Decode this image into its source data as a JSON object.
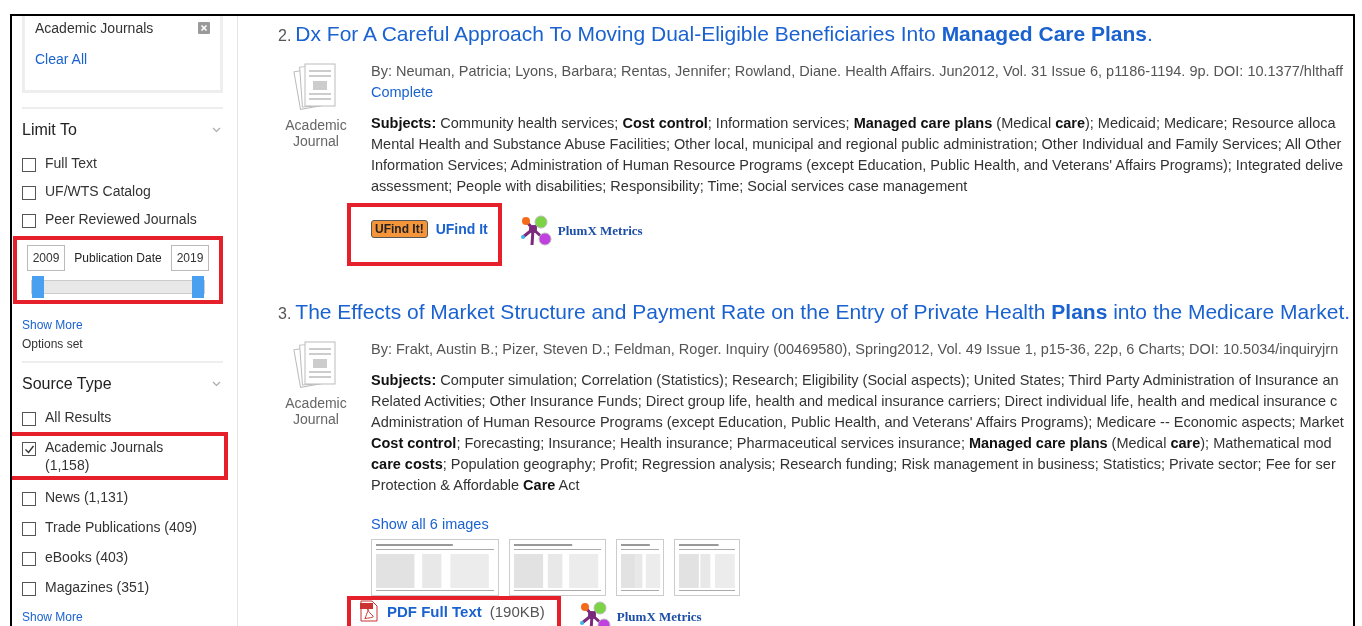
{
  "applied_filters": {
    "items": [
      {
        "label": "Academic Journals"
      }
    ],
    "clear_all": "Clear All"
  },
  "limit_to": {
    "title": "Limit To",
    "options": [
      {
        "label": "Full Text",
        "checked": false
      },
      {
        "label": "UF/WTS Catalog",
        "checked": false
      },
      {
        "label": "Peer Reviewed Journals",
        "checked": false
      }
    ],
    "date_filter": {
      "from": "2009",
      "label": "Publication Date",
      "to": "2019",
      "highlighted": true,
      "thumbs": [
        {
          "level": 0
        },
        {
          "level": 1
        }
      ]
    },
    "show_more": "Show More",
    "status": "Options set"
  },
  "source_type": {
    "title": "Source Type",
    "options": [
      {
        "label": "All Results",
        "checked": false,
        "highlighted": false
      },
      {
        "label": "Academic Journals (1,158)",
        "checked": true,
        "highlighted": true
      },
      {
        "label": "News (1,131)",
        "checked": false,
        "highlighted": false
      },
      {
        "label": "Trade Publications (409)",
        "checked": false,
        "highlighted": false
      },
      {
        "label": "eBooks (403)",
        "checked": false,
        "highlighted": false
      },
      {
        "label": "Magazines (351)",
        "checked": false,
        "highlighted": false
      }
    ],
    "show_more": "Show More"
  },
  "results": [
    {
      "number": "2.",
      "title": "Dx For A Careful Approach To Moving Dual-Eligible Beneficiaries Into **Managed Care Plans**.",
      "type": "Academic Journal",
      "by_line": "By: Neuman, Patricia; Lyons, Barbara; Rentas, Jennifer; Rowland, Diane. Health Affairs. Jun2012, Vol. 31 Issue 6, p1186-1194. 9p. DOI: 10.1377/hlthaff",
      "by_link": "Complete",
      "subjects": [
        "**Subjects:** Community health services; **Cost control**; Information services; **Managed care plans** (Medical **care**); Medicaid; Medicare; Resource alloca",
        "Mental Health and Substance Abuse Facilities; Other local, municipal and regional public administration; Other Individual and Family Services; All Other",
        "Information Services; Administration of Human Resource Programs (except Education, Public Health, and Veterans' Affairs Programs); Integrated delive",
        "assessment; People with disabilities; Responsibility; Time; Social services case management"
      ],
      "links": [
        {
          "kind": "ufind",
          "badge": "UFind It!",
          "label": "UFind It",
          "highlighted": true
        },
        {
          "kind": "plumx",
          "label": "PlumX Metrics",
          "highlighted": false
        }
      ]
    },
    {
      "number": "3.",
      "title": "The Effects of Market Structure and Payment Rate on the Entry of Private Health **Plans** into the Medicare Market.",
      "type": "Academic Journal",
      "by_line": "By: Frakt, Austin B.; Pizer, Steven D.; Feldman, Roger. Inquiry (00469580), Spring2012, Vol. 49 Issue 1, p15-36, 22p, 6 Charts; DOI: 10.5034/inquiryjrn",
      "subjects": [
        "**Subjects:** Computer simulation; Correlation (Statistics); Research; Eligibility (Social aspects); United States; Third Party Administration of Insurance an",
        "Related Activities; Other Insurance Funds; Direct group life, health and medical insurance carriers; Direct individual life, health and medical insurance c",
        "Administration of Human Resource Programs (except Education, Public Health, and Veterans' Affairs Programs); Medicare -- Economic aspects; Market",
        "**Cost control**; Forecasting; Insurance; Health insurance; Pharmaceutical services insurance; **Managed care plans** (Medical **care**); Mathematical mod",
        "**care costs**; Population geography; Profit; Regression analysis; Research funding; Risk management in business; Statistics; Private sector; Fee for ser",
        "Protection & Affordable **Care** Act"
      ],
      "images_link": "Show all 6 images",
      "images": [
        {
          "kind": "picture"
        },
        {
          "kind": "picture"
        },
        {
          "kind": "picture"
        },
        {
          "kind": "picture"
        }
      ],
      "links": [
        {
          "kind": "pdf",
          "label": "PDF Full Text",
          "size": "(190KB)",
          "highlighted": true
        },
        {
          "kind": "plumx",
          "label": "PlumX Metrics",
          "highlighted": false
        }
      ]
    }
  ]
}
